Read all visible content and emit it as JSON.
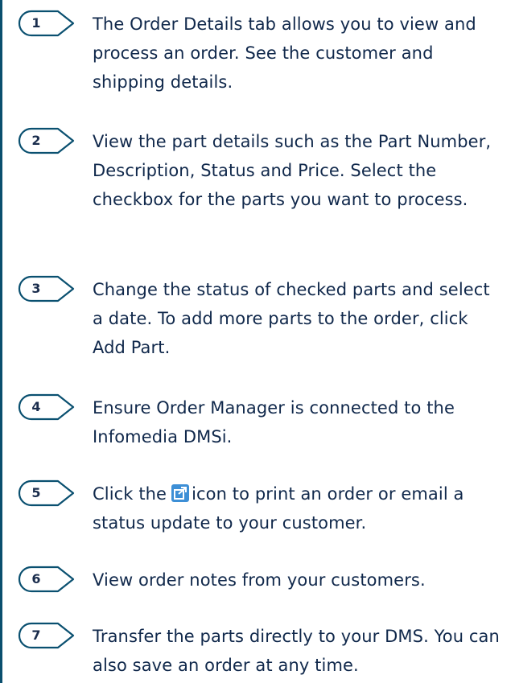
{
  "steps": [
    {
      "number": "1",
      "text": "The Order Details tab allows you to view and process an order. See the customer and shipping details."
    },
    {
      "number": "2",
      "text": "View the part details such as the Part Number, Description, Status and Price. Select the checkbox for the parts you want to process."
    },
    {
      "number": "3",
      "text": "Change the status of checked parts and select a date. To add more parts to the order, click Add Part."
    },
    {
      "number": "4",
      "text": "Ensure Order Manager is connected to the Infomedia DMSi."
    },
    {
      "number": "5",
      "text_before_icon": "Click the",
      "icon": "share-export-icon",
      "text_after_icon": "icon to print an order or email a status update to your customer."
    },
    {
      "number": "6",
      "text": "View order notes from your customers."
    },
    {
      "number": "7",
      "text": "Transfer the parts directly to your DMS. You can also save an order at any time."
    }
  ],
  "colors": {
    "text": "#10284b",
    "badge_stroke": "#0a5070",
    "icon_fill": "#3d8fd6"
  }
}
